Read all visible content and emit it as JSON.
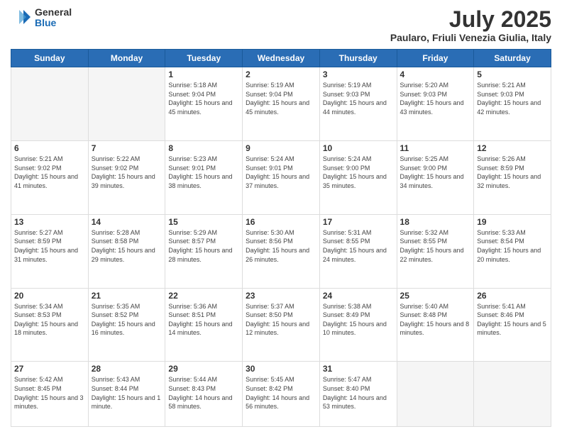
{
  "logo": {
    "general": "General",
    "blue": "Blue"
  },
  "header": {
    "month": "July 2025",
    "location": "Paularo, Friuli Venezia Giulia, Italy"
  },
  "days_of_week": [
    "Sunday",
    "Monday",
    "Tuesday",
    "Wednesday",
    "Thursday",
    "Friday",
    "Saturday"
  ],
  "weeks": [
    [
      {
        "day": "",
        "info": ""
      },
      {
        "day": "",
        "info": ""
      },
      {
        "day": "1",
        "info": "Sunrise: 5:18 AM\nSunset: 9:04 PM\nDaylight: 15 hours and 45 minutes."
      },
      {
        "day": "2",
        "info": "Sunrise: 5:19 AM\nSunset: 9:04 PM\nDaylight: 15 hours and 45 minutes."
      },
      {
        "day": "3",
        "info": "Sunrise: 5:19 AM\nSunset: 9:03 PM\nDaylight: 15 hours and 44 minutes."
      },
      {
        "day": "4",
        "info": "Sunrise: 5:20 AM\nSunset: 9:03 PM\nDaylight: 15 hours and 43 minutes."
      },
      {
        "day": "5",
        "info": "Sunrise: 5:21 AM\nSunset: 9:03 PM\nDaylight: 15 hours and 42 minutes."
      }
    ],
    [
      {
        "day": "6",
        "info": "Sunrise: 5:21 AM\nSunset: 9:02 PM\nDaylight: 15 hours and 41 minutes."
      },
      {
        "day": "7",
        "info": "Sunrise: 5:22 AM\nSunset: 9:02 PM\nDaylight: 15 hours and 39 minutes."
      },
      {
        "day": "8",
        "info": "Sunrise: 5:23 AM\nSunset: 9:01 PM\nDaylight: 15 hours and 38 minutes."
      },
      {
        "day": "9",
        "info": "Sunrise: 5:24 AM\nSunset: 9:01 PM\nDaylight: 15 hours and 37 minutes."
      },
      {
        "day": "10",
        "info": "Sunrise: 5:24 AM\nSunset: 9:00 PM\nDaylight: 15 hours and 35 minutes."
      },
      {
        "day": "11",
        "info": "Sunrise: 5:25 AM\nSunset: 9:00 PM\nDaylight: 15 hours and 34 minutes."
      },
      {
        "day": "12",
        "info": "Sunrise: 5:26 AM\nSunset: 8:59 PM\nDaylight: 15 hours and 32 minutes."
      }
    ],
    [
      {
        "day": "13",
        "info": "Sunrise: 5:27 AM\nSunset: 8:59 PM\nDaylight: 15 hours and 31 minutes."
      },
      {
        "day": "14",
        "info": "Sunrise: 5:28 AM\nSunset: 8:58 PM\nDaylight: 15 hours and 29 minutes."
      },
      {
        "day": "15",
        "info": "Sunrise: 5:29 AM\nSunset: 8:57 PM\nDaylight: 15 hours and 28 minutes."
      },
      {
        "day": "16",
        "info": "Sunrise: 5:30 AM\nSunset: 8:56 PM\nDaylight: 15 hours and 26 minutes."
      },
      {
        "day": "17",
        "info": "Sunrise: 5:31 AM\nSunset: 8:55 PM\nDaylight: 15 hours and 24 minutes."
      },
      {
        "day": "18",
        "info": "Sunrise: 5:32 AM\nSunset: 8:55 PM\nDaylight: 15 hours and 22 minutes."
      },
      {
        "day": "19",
        "info": "Sunrise: 5:33 AM\nSunset: 8:54 PM\nDaylight: 15 hours and 20 minutes."
      }
    ],
    [
      {
        "day": "20",
        "info": "Sunrise: 5:34 AM\nSunset: 8:53 PM\nDaylight: 15 hours and 18 minutes."
      },
      {
        "day": "21",
        "info": "Sunrise: 5:35 AM\nSunset: 8:52 PM\nDaylight: 15 hours and 16 minutes."
      },
      {
        "day": "22",
        "info": "Sunrise: 5:36 AM\nSunset: 8:51 PM\nDaylight: 15 hours and 14 minutes."
      },
      {
        "day": "23",
        "info": "Sunrise: 5:37 AM\nSunset: 8:50 PM\nDaylight: 15 hours and 12 minutes."
      },
      {
        "day": "24",
        "info": "Sunrise: 5:38 AM\nSunset: 8:49 PM\nDaylight: 15 hours and 10 minutes."
      },
      {
        "day": "25",
        "info": "Sunrise: 5:40 AM\nSunset: 8:48 PM\nDaylight: 15 hours and 8 minutes."
      },
      {
        "day": "26",
        "info": "Sunrise: 5:41 AM\nSunset: 8:46 PM\nDaylight: 15 hours and 5 minutes."
      }
    ],
    [
      {
        "day": "27",
        "info": "Sunrise: 5:42 AM\nSunset: 8:45 PM\nDaylight: 15 hours and 3 minutes."
      },
      {
        "day": "28",
        "info": "Sunrise: 5:43 AM\nSunset: 8:44 PM\nDaylight: 15 hours and 1 minute."
      },
      {
        "day": "29",
        "info": "Sunrise: 5:44 AM\nSunset: 8:43 PM\nDaylight: 14 hours and 58 minutes."
      },
      {
        "day": "30",
        "info": "Sunrise: 5:45 AM\nSunset: 8:42 PM\nDaylight: 14 hours and 56 minutes."
      },
      {
        "day": "31",
        "info": "Sunrise: 5:47 AM\nSunset: 8:40 PM\nDaylight: 14 hours and 53 minutes."
      },
      {
        "day": "",
        "info": ""
      },
      {
        "day": "",
        "info": ""
      }
    ]
  ]
}
